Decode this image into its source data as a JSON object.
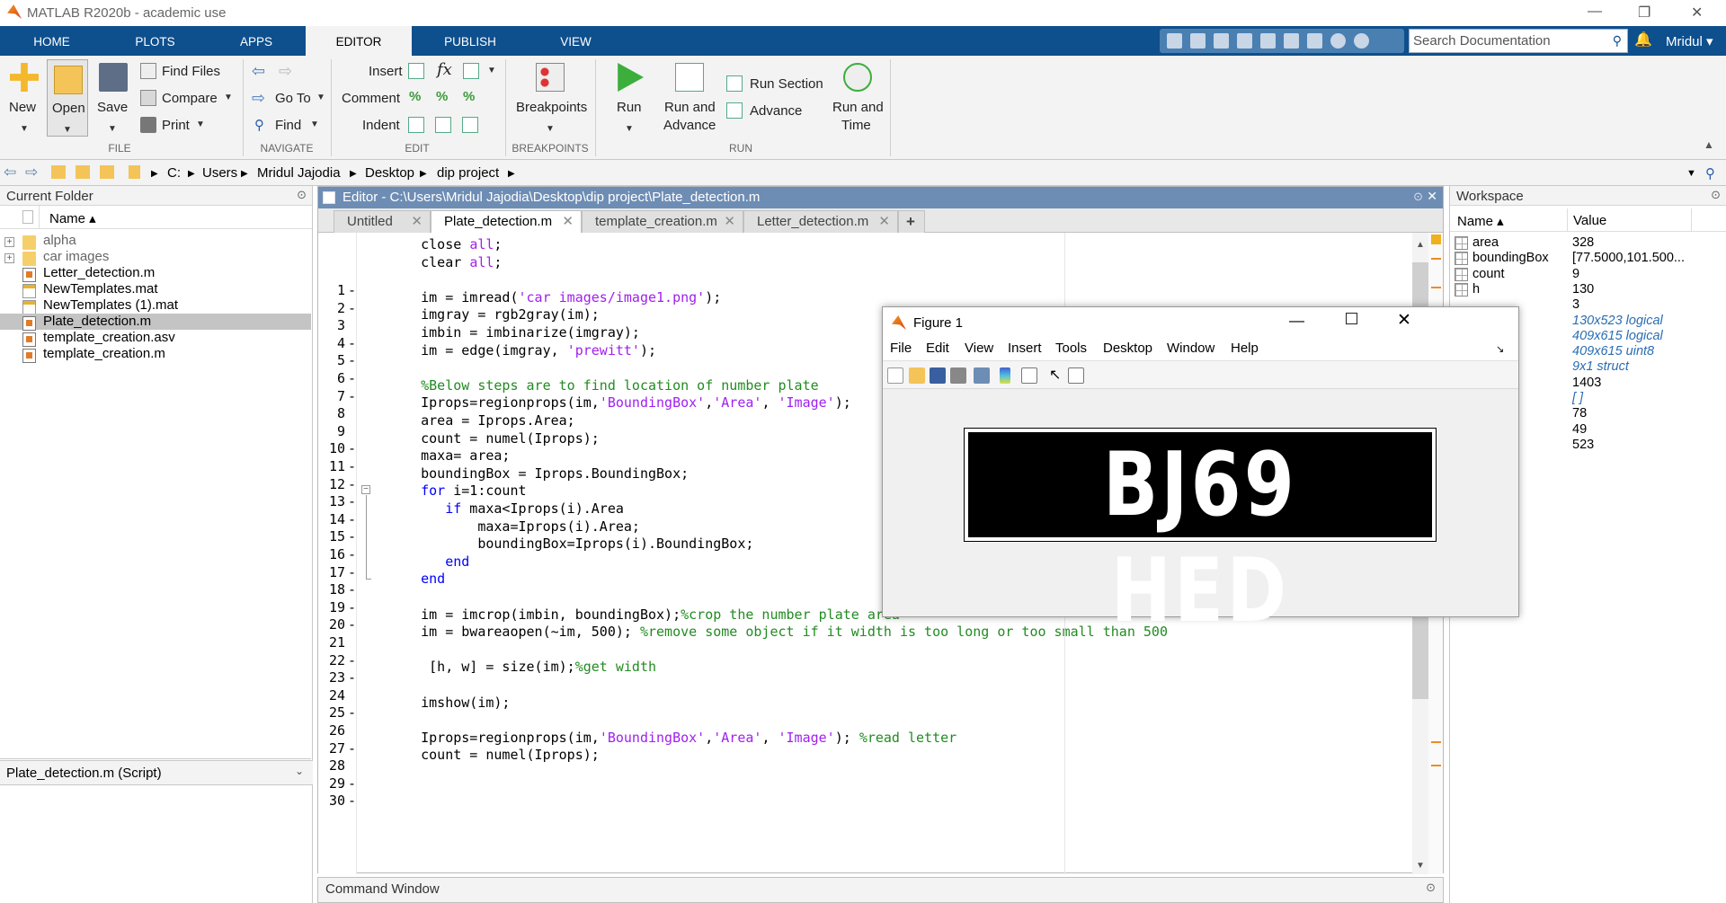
{
  "window": {
    "title": "MATLAB R2020b - academic use",
    "minimize": "—",
    "restore": "❐",
    "close": "✕"
  },
  "tabs": [
    "HOME",
    "PLOTS",
    "APPS",
    "EDITOR",
    "PUBLISH",
    "VIEW"
  ],
  "search": {
    "placeholder": "Search Documentation"
  },
  "user": "Mridul ▾",
  "ribbon": {
    "new": "New",
    "open": "Open",
    "save": "Save",
    "find_files": "Find Files",
    "compare": "Compare",
    "print": "Print",
    "go_to": "Go To",
    "find": "Find",
    "insert": "Insert",
    "comment": "Comment",
    "indent": "Indent",
    "breakpoints": "Breakpoints",
    "run": "Run",
    "run_and_advance": [
      "Run and",
      "Advance"
    ],
    "run_section": "Run Section",
    "advance": "Advance",
    "run_and_time": [
      "Run and",
      "Time"
    ],
    "sections": {
      "file": "FILE",
      "navigate": "NAVIGATE",
      "edit": "EDIT",
      "breakpoints": "BREAKPOINTS",
      "run": "RUN"
    }
  },
  "address": {
    "path": [
      "C:",
      "Users",
      "Mridul Jajodia",
      "Desktop",
      "dip project"
    ]
  },
  "current_folder": {
    "title": "Current Folder",
    "col_name": "Name ▴",
    "items": [
      {
        "name": "alpha",
        "type": "folder"
      },
      {
        "name": "car images",
        "type": "folder"
      },
      {
        "name": "Letter_detection.m",
        "type": "m"
      },
      {
        "name": "NewTemplates.mat",
        "type": "mat"
      },
      {
        "name": "NewTemplates (1).mat",
        "type": "mat"
      },
      {
        "name": "Plate_detection.m",
        "type": "m"
      },
      {
        "name": "template_creation.asv",
        "type": "asv"
      },
      {
        "name": "template_creation.m",
        "type": "m"
      }
    ],
    "details": "Plate_detection.m  (Script)"
  },
  "editor": {
    "title": "Editor - C:\\Users\\Mridul Jajodia\\Desktop\\dip project\\Plate_detection.m",
    "tabs": [
      "Untitled",
      "Plate_detection.m",
      "template_creation.m",
      "Letter_detection.m"
    ],
    "add_tab": "+",
    "lines": [
      [
        [
          "    close ",
          ""
        ],
        [
          "all",
          "st"
        ],
        [
          ";",
          ""
        ]
      ],
      [
        [
          "    clear ",
          ""
        ],
        [
          "all",
          "st"
        ],
        [
          ";",
          ""
        ]
      ],
      [],
      [
        [
          "    im = imread(",
          ""
        ],
        [
          "'car images/image1.png'",
          "st"
        ],
        [
          ");",
          ""
        ]
      ],
      [
        [
          "    imgray = rgb2gray(im);",
          ""
        ]
      ],
      [
        [
          "    imbin = imbinarize(imgray);",
          ""
        ]
      ],
      [
        [
          "    im = edge(imgray, ",
          ""
        ],
        [
          "'prewitt'",
          "st"
        ],
        [
          ");",
          ""
        ]
      ],
      [],
      [
        [
          "    %Below steps are to find location of number plate",
          "cm"
        ]
      ],
      [
        [
          "    Iprops=regionprops(im,",
          ""
        ],
        [
          "'BoundingBox'",
          "st"
        ],
        [
          ",",
          ""
        ],
        [
          "'Area'",
          "st"
        ],
        [
          ", ",
          ""
        ],
        [
          "'Image'",
          "st"
        ],
        [
          ");",
          ""
        ]
      ],
      [
        [
          "    area = Iprops.Area;",
          ""
        ]
      ],
      [
        [
          "    count = numel(Iprops);",
          ""
        ]
      ],
      [
        [
          "    maxa= area;",
          ""
        ]
      ],
      [
        [
          "    boundingBox = Iprops.BoundingBox;",
          ""
        ]
      ],
      [
        [
          "    ",
          ""
        ],
        [
          "for",
          "kw"
        ],
        [
          " i=1:count",
          ""
        ]
      ],
      [
        [
          "       ",
          ""
        ],
        [
          "if",
          "kw"
        ],
        [
          " maxa<Iprops(i).Area",
          ""
        ]
      ],
      [
        [
          "           maxa=Iprops(i).Area;",
          ""
        ]
      ],
      [
        [
          "           boundingBox=Iprops(i).BoundingBox;",
          ""
        ]
      ],
      [
        [
          "       ",
          ""
        ],
        [
          "end",
          "kw"
        ]
      ],
      [
        [
          "    ",
          ""
        ],
        [
          "end",
          "kw"
        ]
      ],
      [],
      [
        [
          "    im = imcrop(imbin, boundingBox);",
          ""
        ],
        [
          "%crop the number plate area",
          "cm"
        ]
      ],
      [
        [
          "    im = bwareaopen(~im, 500); ",
          ""
        ],
        [
          "%remove some object if it width is too long or too small than 500",
          "cm"
        ]
      ],
      [],
      [
        [
          "     [h, w] = size(im);",
          ""
        ],
        [
          "%get width",
          "cm"
        ]
      ],
      [],
      [
        [
          "    imshow(im);",
          ""
        ]
      ],
      [],
      [
        [
          "    Iprops=regionprops(im,",
          ""
        ],
        [
          "'BoundingBox'",
          "st"
        ],
        [
          ",",
          ""
        ],
        [
          "'Area'",
          "st"
        ],
        [
          ", ",
          ""
        ],
        [
          "'Image'",
          "st"
        ],
        [
          "); ",
          ""
        ],
        [
          "%read letter",
          "cm"
        ]
      ],
      [
        [
          "    count = numel(Iprops);",
          ""
        ]
      ]
    ]
  },
  "command_window": {
    "title": "Command Window"
  },
  "workspace": {
    "title": "Workspace",
    "col_name": "Name ▴",
    "col_value": "Value",
    "rows": [
      {
        "name": "area",
        "value": "328",
        "italic": false
      },
      {
        "name": "boundingBox",
        "value": "[77.5000,101.500...",
        "italic": false
      },
      {
        "name": "count",
        "value": "9",
        "italic": false
      },
      {
        "name": "h",
        "value": "130",
        "italic": false
      },
      {
        "name": "",
        "value": "3",
        "italic": false
      },
      {
        "name": "",
        "value": "130x523 logical",
        "italic": true
      },
      {
        "name": "",
        "value": "409x615 logical",
        "italic": true
      },
      {
        "name": "",
        "value": "409x615 uint8",
        "italic": true
      },
      {
        "name": "",
        "value": "9x1 struct",
        "italic": true
      },
      {
        "name": "",
        "value": "1403",
        "italic": false
      },
      {
        "name": "",
        "value": "[ ]",
        "italic": true
      },
      {
        "name": "",
        "value": "78",
        "italic": false
      },
      {
        "name": "",
        "value": "49",
        "italic": false
      },
      {
        "name": "",
        "value": "523",
        "italic": false
      }
    ]
  },
  "figure": {
    "title": "Figure 1",
    "menu": [
      "File",
      "Edit",
      "View",
      "Insert",
      "Tools",
      "Desktop",
      "Window",
      "Help"
    ],
    "plate_text": "BJ69 HED"
  }
}
